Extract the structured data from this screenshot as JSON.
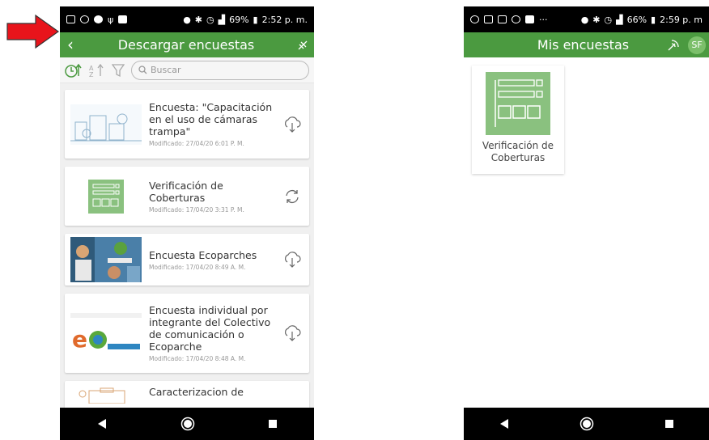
{
  "left": {
    "status": {
      "icons": [
        "photo-icon",
        "shield-icon",
        "location-icon",
        "usb-icon",
        "gallery-icon"
      ],
      "battery": "69%",
      "time": "2:52 p. m."
    },
    "appbar": {
      "title": "Descargar encuestas"
    },
    "toolbar": {
      "search_placeholder": "Buscar"
    },
    "surveys": [
      {
        "title": "Encuesta: \"Capacitación en el uso de cámaras trampa\"",
        "date": "Modificado: 27/04/20 6:01 P. M.",
        "action": "download-icon"
      },
      {
        "title": "Verificación de Coberturas",
        "date": "Modificado: 17/04/20 3:31 P. M.",
        "action": "sync-icon"
      },
      {
        "title": "Encuesta Ecoparches",
        "date": "Modificado: 17/04/20 8:49 A. M.",
        "action": "download-icon"
      },
      {
        "title": "Encuesta individual por integrante del Colectivo de comunicación o Ecoparche",
        "date": "Modificado: 17/04/20 8:48 A. M.",
        "action": "download-icon"
      },
      {
        "title": "Caracterizacion de",
        "date": "",
        "action": "download-icon"
      }
    ]
  },
  "right": {
    "status": {
      "battery": "66%",
      "time": "2:59 p. m"
    },
    "appbar": {
      "title": "Mis encuestas",
      "avatar": "SF"
    },
    "tile": {
      "label": "Verificación de Coberturas"
    }
  },
  "colors": {
    "appbar": "#4b9a40",
    "arrow": "#e8141b"
  }
}
